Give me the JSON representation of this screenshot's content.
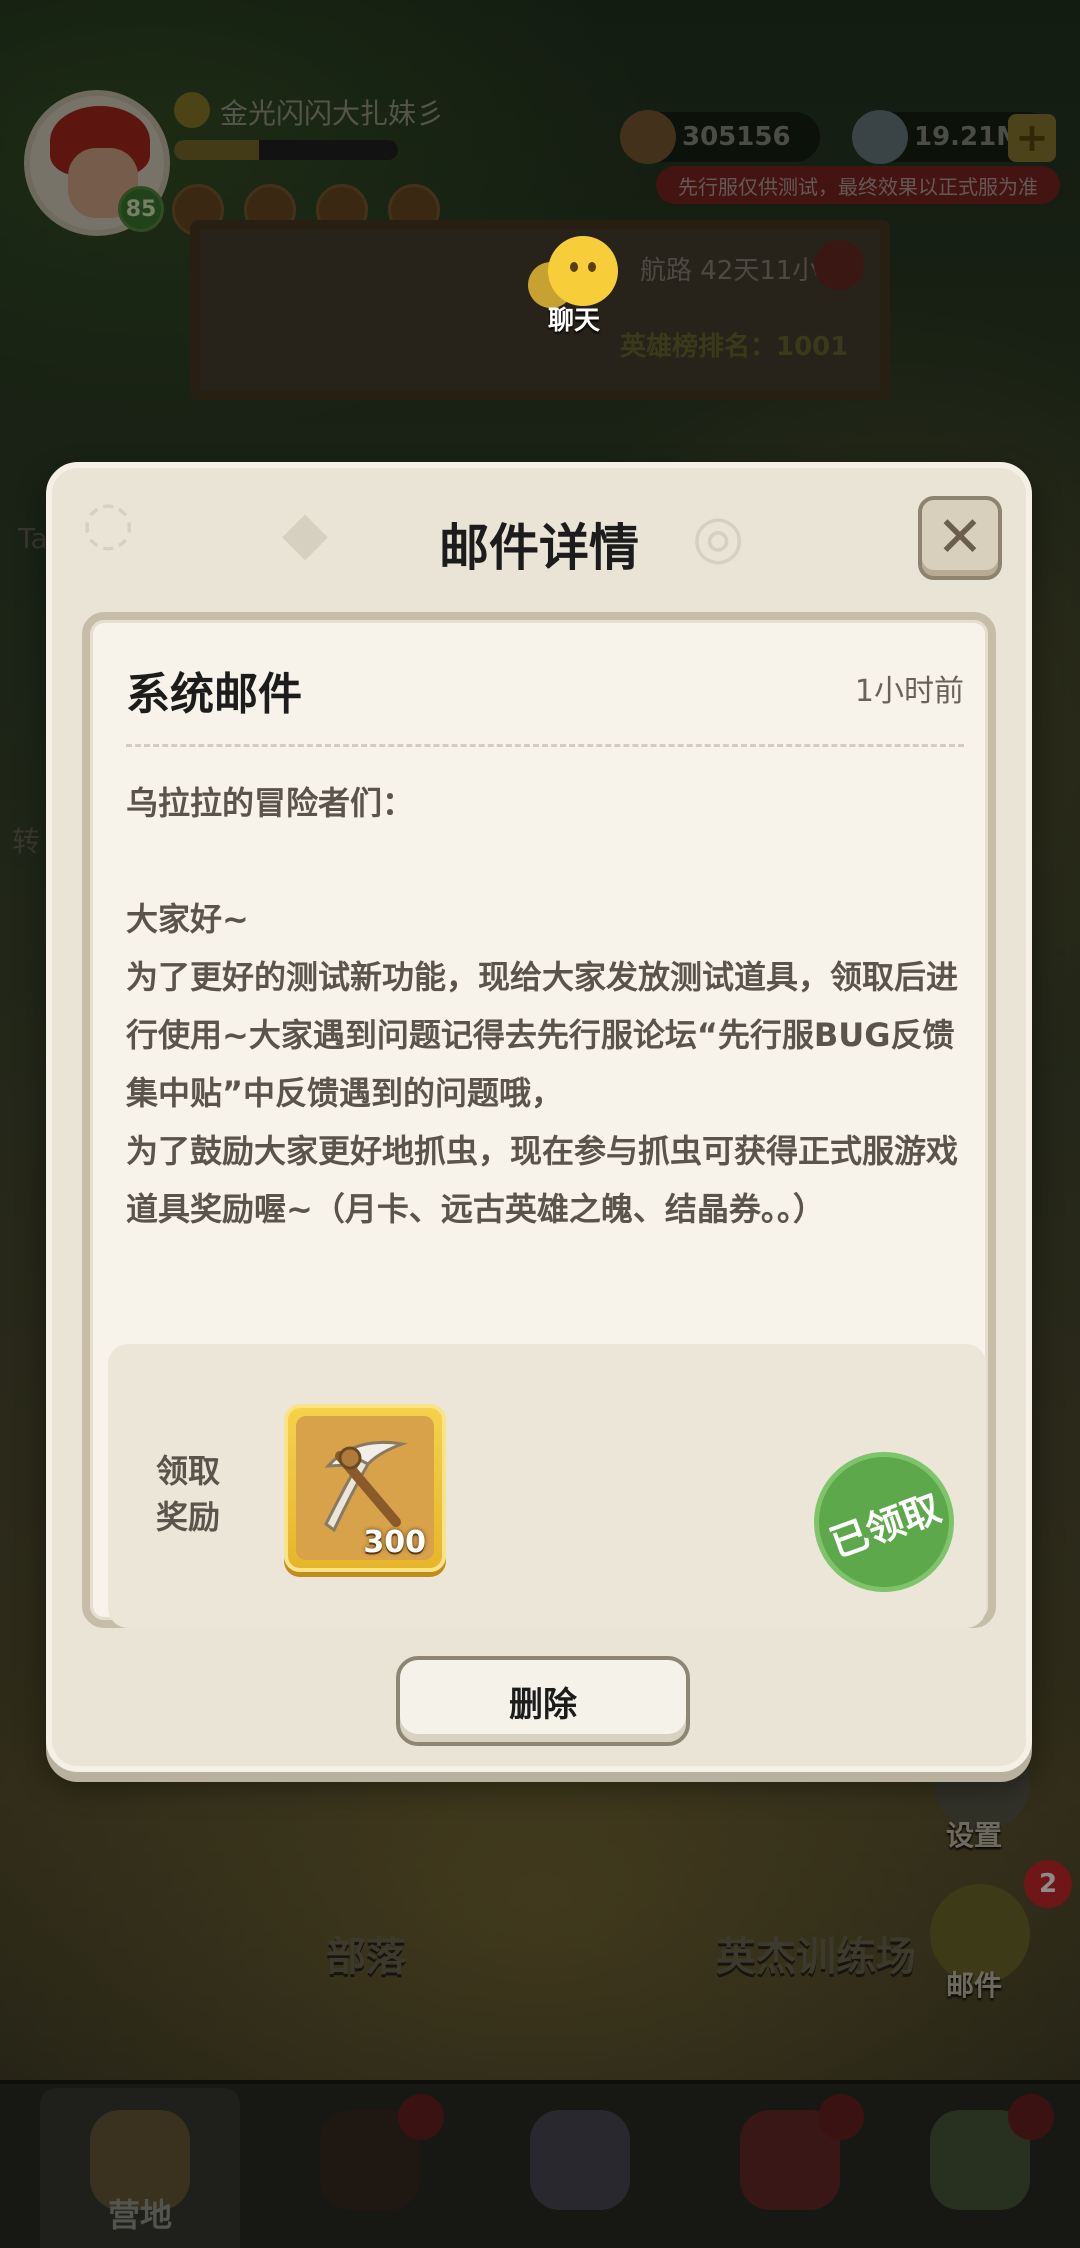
{
  "hud": {
    "player_name": "金光闪闪大扎妹彡",
    "level": "85",
    "xp_progress": 0.38,
    "gold": "305156",
    "gems": "19.21M",
    "plus_symbol": "+",
    "test_notice": "先行服仅供测试，最终效果以正式服为准"
  },
  "event": {
    "text1": "航路 42天11小",
    "text2": "英雄榜排名：1001"
  },
  "chat": {
    "label": "聊天"
  },
  "side": {
    "left_label_1": "Ta",
    "left_label_2": "转"
  },
  "background": {
    "tribe_label": "部落",
    "training_label": "英杰训练场",
    "settings_label": "设置",
    "mail_label": "邮件",
    "mail_count": "2"
  },
  "bottom_nav": {
    "camp_label": "营地"
  },
  "modal": {
    "title": "邮件详情",
    "close_symbol": "✕",
    "mail": {
      "subject": "系统邮件",
      "time": "1小时前",
      "body": "乌拉拉的冒险者们：\n\n大家好~\n为了更好的测试新功能，现给大家发放测试道具，领取后进行使用~大家遇到问题记得去先行服论坛“先行服BUG反馈集中贴”中反馈遇到的问题哦，\n为了鼓励大家更好地抓虫，现在参与抓虫可获得正式服游戏道具奖励喔~（月卡、远古英雄之魄、结晶券。。）"
    },
    "reward": {
      "label": "领取奖励",
      "item_icon": "pickaxe-icon",
      "item_count": "300",
      "claimed_stamp": "已领取"
    },
    "delete_button": "删除"
  },
  "colors": {
    "modal_bg": "#e9e4d6",
    "card_bg": "#f7f3ea",
    "claimed_green": "#5ea84c",
    "reward_gold": "#f5d24a"
  }
}
